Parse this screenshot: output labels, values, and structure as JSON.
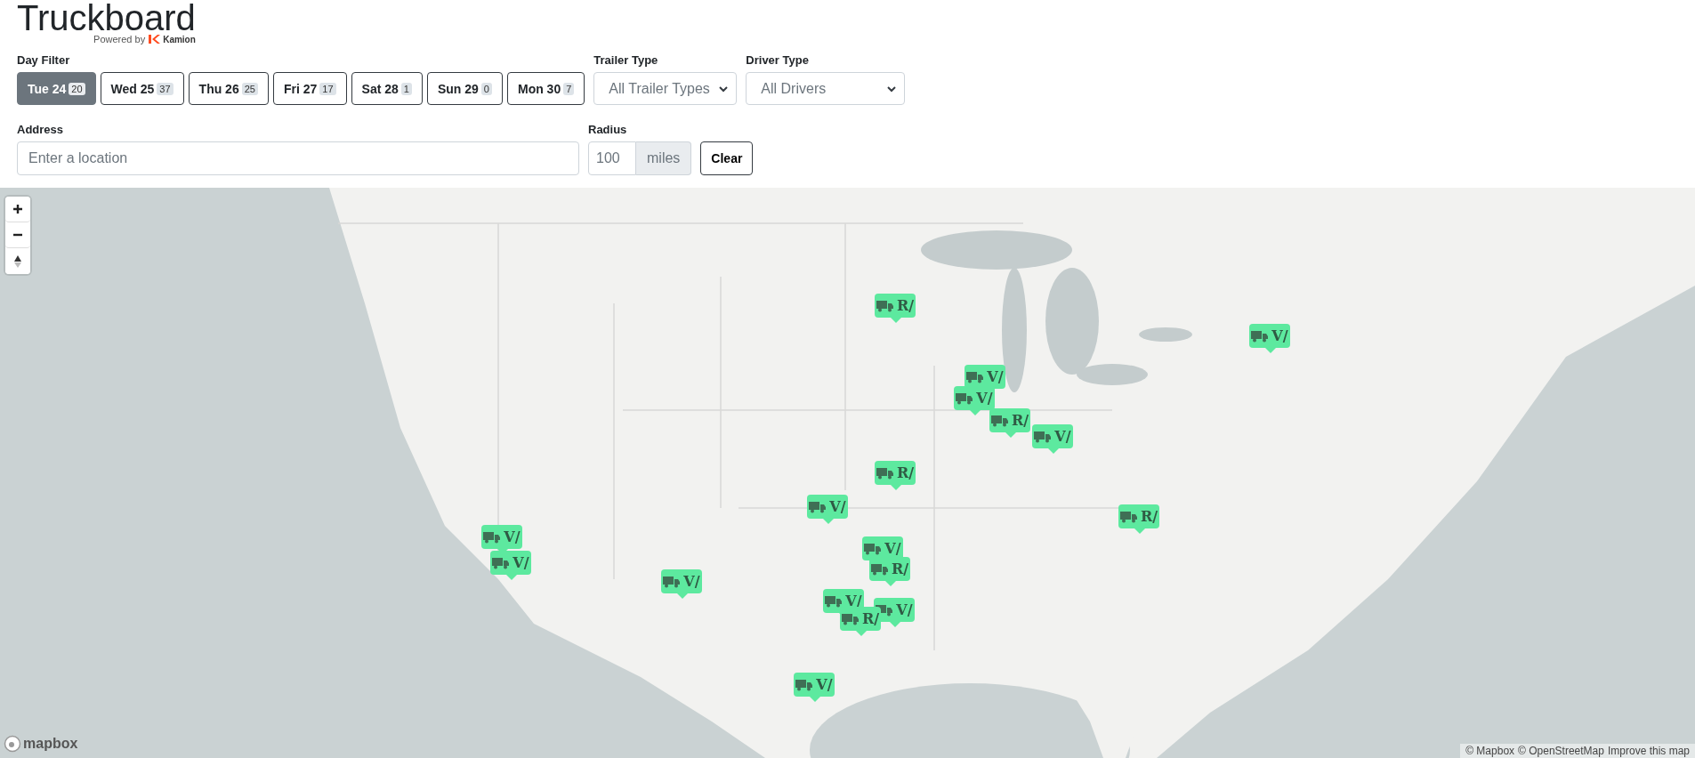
{
  "header": {
    "title": "Truckboard",
    "powered_by": "Powered by",
    "brand": "Kamion"
  },
  "day_filter": {
    "label": "Day Filter",
    "days": [
      {
        "label": "Tue 24",
        "count": "20",
        "selected": true
      },
      {
        "label": "Wed 25",
        "count": "37",
        "selected": false
      },
      {
        "label": "Thu 26",
        "count": "25",
        "selected": false
      },
      {
        "label": "Fri 27",
        "count": "17",
        "selected": false
      },
      {
        "label": "Sat 28",
        "count": "1",
        "selected": false
      },
      {
        "label": "Sun 29",
        "count": "0",
        "selected": false
      },
      {
        "label": "Mon 30",
        "count": "7",
        "selected": false
      }
    ]
  },
  "trailer_type": {
    "label": "Trailer Type",
    "value": "All Trailer Types"
  },
  "driver_type": {
    "label": "Driver Type",
    "value": "All Drivers"
  },
  "address": {
    "label": "Address",
    "placeholder": "Enter a location"
  },
  "radius": {
    "label": "Radius",
    "value": "100",
    "unit": "miles"
  },
  "clear_button": "Clear",
  "map": {
    "markers": [
      {
        "label": "R/"
      },
      {
        "label": "V/"
      },
      {
        "label": "V/"
      },
      {
        "label": "V/"
      },
      {
        "label": "R/"
      },
      {
        "label": "V/"
      },
      {
        "label": "R/"
      },
      {
        "label": "V/"
      },
      {
        "label": "R/"
      },
      {
        "label": "V/"
      },
      {
        "label": "V/"
      },
      {
        "label": "V/"
      },
      {
        "label": "V/"
      },
      {
        "label": "R/"
      },
      {
        "label": "V/"
      },
      {
        "label": "V/"
      },
      {
        "label": "R/"
      },
      {
        "label": "V/"
      }
    ],
    "logo": "mapbox",
    "attribution": [
      "© Mapbox",
      "© OpenStreetMap",
      "Improve this map"
    ]
  }
}
